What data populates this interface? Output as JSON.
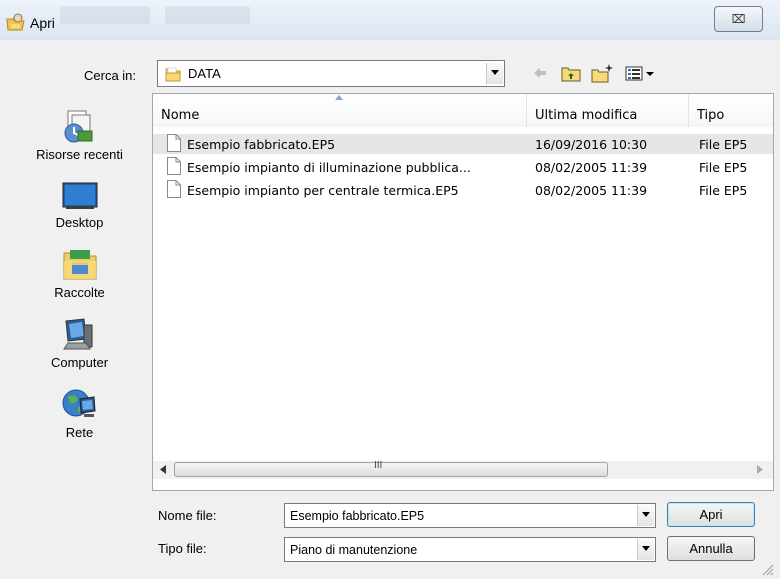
{
  "window": {
    "title": "Apri",
    "close_glyph": "⌧"
  },
  "look_in": {
    "label": "Cerca in:",
    "value": "DATA"
  },
  "toolbar": {
    "icons": [
      "back-arrow-icon",
      "up-folder-icon",
      "new-folder-icon",
      "view-menu-icon"
    ]
  },
  "places": [
    {
      "label": "Risorse recenti",
      "icon": "recent-places-icon"
    },
    {
      "label": "Desktop",
      "icon": "desktop-icon"
    },
    {
      "label": "Raccolte",
      "icon": "libraries-icon"
    },
    {
      "label": "Computer",
      "icon": "computer-icon"
    },
    {
      "label": "Rete",
      "icon": "network-icon"
    }
  ],
  "file_list": {
    "columns": [
      "Nome",
      "Ultima modifica",
      "Tipo"
    ],
    "rows": [
      {
        "name": "Esempio fabbricato.EP5",
        "modified": "16/09/2016 10:30",
        "type": "File EP5",
        "selected": true
      },
      {
        "name": "Esempio impianto di illuminazione pubblica...",
        "modified": "08/02/2005 11:39",
        "type": "File EP5",
        "selected": false
      },
      {
        "name": "Esempio impianto per centrale termica.EP5",
        "modified": "08/02/2005 11:39",
        "type": "File EP5",
        "selected": false
      }
    ],
    "scroll_grip": "III"
  },
  "file_name": {
    "label": "Nome file:",
    "value": "Esempio fabbricato.EP5"
  },
  "file_type": {
    "label": "Tipo file:",
    "value": "Piano di manutenzione"
  },
  "buttons": {
    "open": "Apri",
    "cancel": "Annulla"
  },
  "colors": {
    "selection": "#e6e6e6",
    "window_bg": "#f0f0f0",
    "title_bg": "#dbe5f2"
  }
}
